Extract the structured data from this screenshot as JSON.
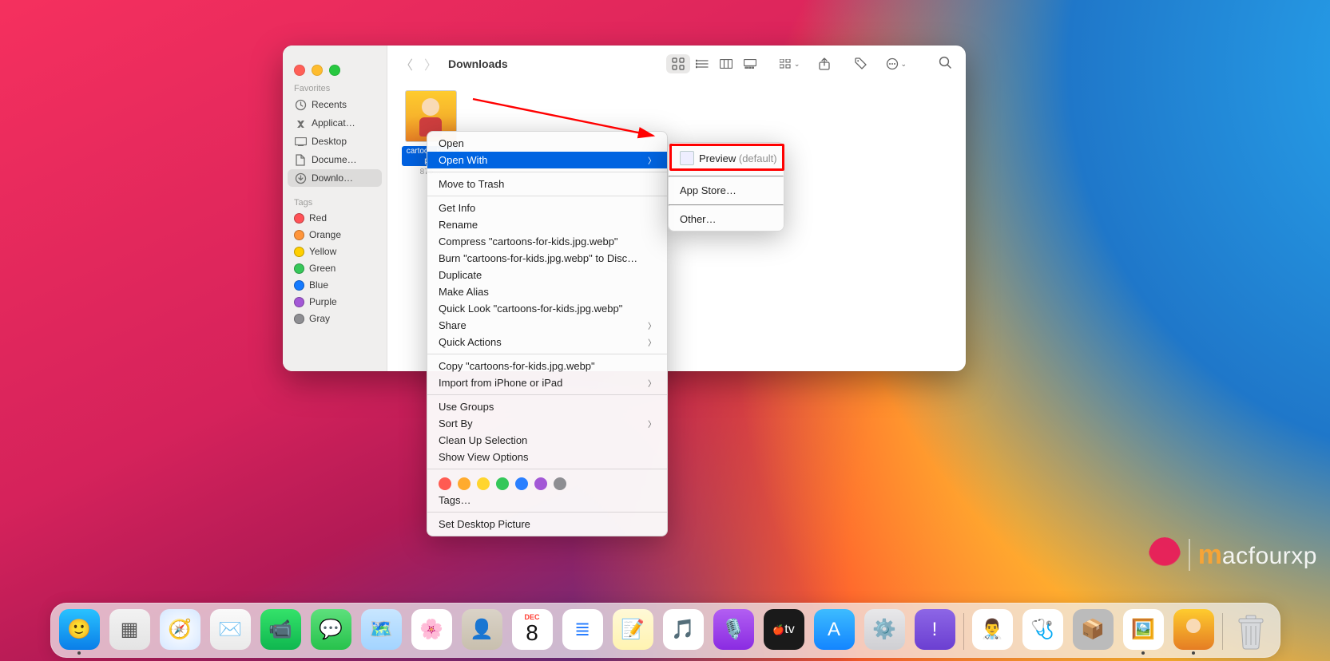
{
  "finder": {
    "title": "Downloads",
    "sidebar": {
      "favorites_head": "Favorites",
      "items": [
        {
          "icon": "clock",
          "label": "Recents"
        },
        {
          "icon": "app",
          "label": "Applicat…"
        },
        {
          "icon": "desk",
          "label": "Desktop"
        },
        {
          "icon": "doc",
          "label": "Docume…"
        },
        {
          "icon": "dl",
          "label": "Downlo…"
        }
      ],
      "active_index": 4,
      "tags_head": "Tags",
      "tags": [
        {
          "cls": "td-red",
          "label": "Red"
        },
        {
          "cls": "td-ora",
          "label": "Orange"
        },
        {
          "cls": "td-yel",
          "label": "Yellow"
        },
        {
          "cls": "td-grn",
          "label": "Green"
        },
        {
          "cls": "td-blu",
          "label": "Blue"
        },
        {
          "cls": "td-pur",
          "label": "Purple"
        },
        {
          "cls": "td-gry",
          "label": "Gray"
        }
      ]
    },
    "file": {
      "name_visible": "cartoo…kids.jp…",
      "sub_visible": "875…"
    }
  },
  "context_menu": {
    "items": [
      {
        "label": "Open"
      },
      {
        "label": "Open With",
        "sub": true,
        "highlight": true
      },
      {
        "sep": true
      },
      {
        "label": "Move to Trash"
      },
      {
        "sep": true
      },
      {
        "label": "Get Info"
      },
      {
        "label": "Rename"
      },
      {
        "label": "Compress \"cartoons-for-kids.jpg.webp\""
      },
      {
        "label": "Burn \"cartoons-for-kids.jpg.webp\" to Disc…"
      },
      {
        "label": "Duplicate"
      },
      {
        "label": "Make Alias"
      },
      {
        "label": "Quick Look \"cartoons-for-kids.jpg.webp\""
      },
      {
        "label": "Share",
        "sub": true
      },
      {
        "label": "Quick Actions",
        "sub": true
      },
      {
        "sep": true
      },
      {
        "label": "Copy \"cartoons-for-kids.jpg.webp\""
      },
      {
        "label": "Import from iPhone or iPad",
        "sub": true
      },
      {
        "sep": true
      },
      {
        "label": "Use Groups"
      },
      {
        "label": "Sort By",
        "sub": true
      },
      {
        "label": "Clean Up Selection"
      },
      {
        "label": "Show View Options"
      },
      {
        "sep": true
      },
      {
        "tags": true
      },
      {
        "label": "Tags…"
      },
      {
        "sep": true
      },
      {
        "label": "Set Desktop Picture"
      }
    ]
  },
  "submenu": {
    "preview_label": "Preview",
    "preview_suffix": "(default)",
    "items2": "App Store…",
    "items3": "Other…"
  },
  "watermark": {
    "m": "m",
    "rest": "acfourxp"
  },
  "dock": {
    "apps": [
      {
        "name": "finder",
        "bg": "linear-gradient(180deg,#29c2ff,#0a7ee8)",
        "glyph": "🙂"
      },
      {
        "name": "launchpad",
        "bg": "linear-gradient(#f2f2f2,#e4e4e4)",
        "glyph": "▦",
        "fg": "#555"
      },
      {
        "name": "safari",
        "bg": "radial-gradient(circle,#fff,#d5e7ff)",
        "glyph": "🧭"
      },
      {
        "name": "mail",
        "bg": "linear-gradient(#fafafa,#eaeaea)",
        "glyph": "✉️",
        "fg": "#2a7fff"
      },
      {
        "name": "facetime",
        "bg": "linear-gradient(#34e26a,#0fb74f)",
        "glyph": "📹"
      },
      {
        "name": "messages",
        "bg": "linear-gradient(#5de07c,#27c24c)",
        "glyph": "💬"
      },
      {
        "name": "maps",
        "bg": "linear-gradient(#c8e6ff,#a3d4ff)",
        "glyph": "🗺️"
      },
      {
        "name": "photos",
        "bg": "#fff",
        "glyph": "🌸"
      },
      {
        "name": "contacts",
        "bg": "linear-gradient(#dad3c7,#c8bfae)",
        "glyph": "👤"
      },
      {
        "name": "calendar",
        "calendar": true,
        "month": "DEC",
        "day": "8"
      },
      {
        "name": "reminders",
        "bg": "#fff",
        "glyph": "≣",
        "fg": "#2a7fff"
      },
      {
        "name": "notes",
        "bg": "linear-gradient(#fff9d7,#fff3b1)",
        "glyph": "📝"
      },
      {
        "name": "music",
        "bg": "#fff",
        "glyph": "🎵",
        "fg": "#fa3d55"
      },
      {
        "name": "podcasts",
        "bg": "linear-gradient(#b25ff2,#8a2be2)",
        "glyph": "🎙️"
      },
      {
        "name": "tv",
        "bg": "#1a1a1a",
        "glyph": "tv",
        "fg": "#fff",
        "small": true
      },
      {
        "name": "appstore",
        "bg": "linear-gradient(#3dbcff,#1385ff)",
        "glyph": "A"
      },
      {
        "name": "settings",
        "bg": "linear-gradient(#e8e8ea,#cfcfd3)",
        "glyph": "⚙️",
        "fg": "#555"
      },
      {
        "name": "feedback",
        "bg": "linear-gradient(#8d66e6,#6b3fd1)",
        "glyph": "!"
      }
    ],
    "right": [
      {
        "name": "sys-info",
        "bg": "#fff",
        "glyph": "👨‍⚕️"
      },
      {
        "name": "disk-util",
        "bg": "#fff",
        "glyph": "🩺"
      },
      {
        "name": "recent-app",
        "bg": "#bbb",
        "glyph": "📦"
      },
      {
        "name": "preview",
        "bg": "#fff",
        "glyph": "🖼️"
      },
      {
        "name": "opened-image",
        "img": true
      }
    ]
  }
}
